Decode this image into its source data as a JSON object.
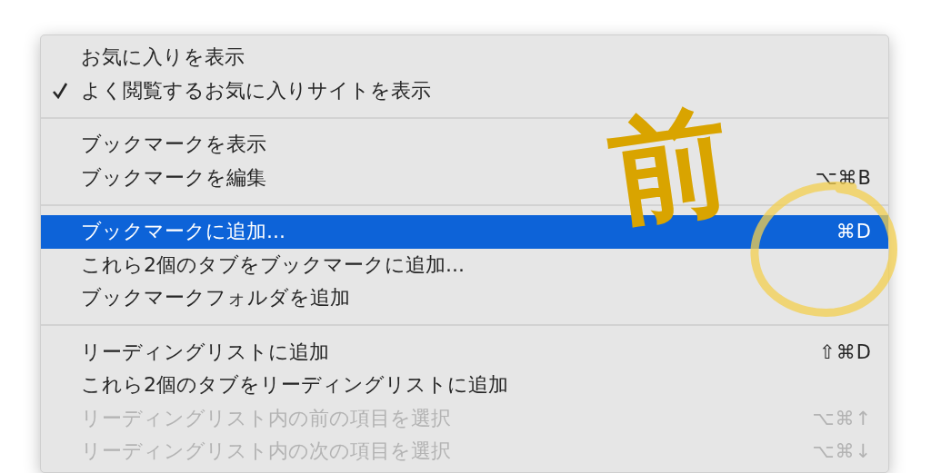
{
  "menu": {
    "sections": [
      {
        "items": [
          {
            "label": "お気に入りを表示",
            "checked": false,
            "disabled": false,
            "selected": false
          },
          {
            "label": "よく閲覧するお気に入りサイトを表示",
            "checked": true,
            "disabled": false,
            "selected": false
          }
        ]
      },
      {
        "items": [
          {
            "label": "ブックマークを表示",
            "checked": false,
            "disabled": false,
            "selected": false
          },
          {
            "label": "ブックマークを編集",
            "shortcut": "⌥⌘B",
            "checked": false,
            "disabled": false,
            "selected": false
          }
        ]
      },
      {
        "items": [
          {
            "label": "ブックマークに追加...",
            "shortcut": "⌘D",
            "checked": false,
            "disabled": false,
            "selected": true
          },
          {
            "label": "これら2個のタブをブックマークに追加...",
            "checked": false,
            "disabled": false,
            "selected": false
          },
          {
            "label": "ブックマークフォルダを追加",
            "checked": false,
            "disabled": false,
            "selected": false
          }
        ]
      },
      {
        "items": [
          {
            "label": "リーディングリストに追加",
            "shortcut": "⇧⌘D",
            "checked": false,
            "disabled": false,
            "selected": false
          },
          {
            "label": "これら2個のタブをリーディングリストに追加",
            "checked": false,
            "disabled": false,
            "selected": false
          },
          {
            "label": "リーディングリスト内の前の項目を選択",
            "shortcut": "⌥⌘↑",
            "checked": false,
            "disabled": true,
            "selected": false
          },
          {
            "label": "リーディングリスト内の次の項目を選択",
            "shortcut": "⌥⌘↓",
            "checked": false,
            "disabled": true,
            "selected": false
          }
        ]
      }
    ]
  },
  "annotation": {
    "text": "前"
  }
}
